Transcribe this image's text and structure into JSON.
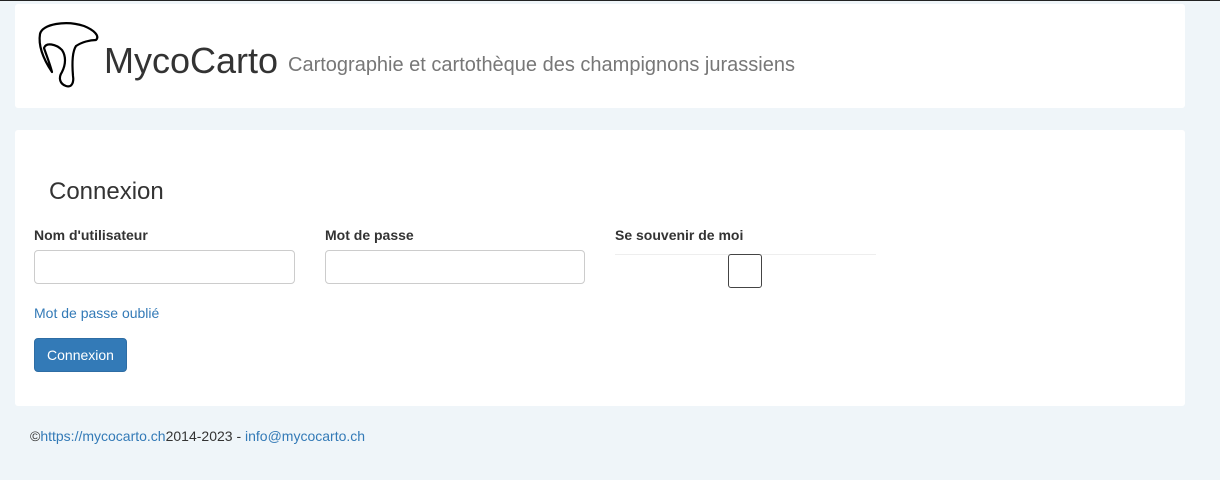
{
  "header": {
    "logo_icon": "mushroom-logo-icon",
    "brand": "MycoCarto",
    "tagline": "Cartographie et cartothèque des champignons jurassiens"
  },
  "login": {
    "title": "Connexion",
    "username": {
      "label": "Nom d'utilisateur",
      "value": ""
    },
    "password": {
      "label": "Mot de passe",
      "value": ""
    },
    "remember": {
      "label": "Se souvenir de moi",
      "checked": false
    },
    "forgot_label": "Mot de passe oublié",
    "submit_label": "Connexion"
  },
  "footer": {
    "copyright": "©",
    "site_link": "https://mycocarto.ch",
    "years": "2014-2023 - ",
    "email": "info@mycocarto.ch"
  },
  "colors": {
    "link": "#337ab7",
    "button": "#337ab7",
    "background": "#eff5f9"
  }
}
